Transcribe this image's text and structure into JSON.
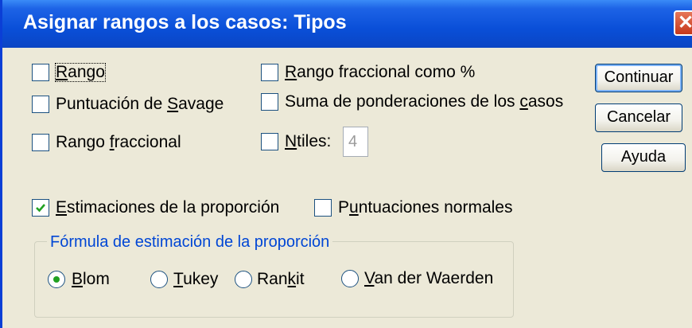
{
  "window": {
    "title": "Asignar rangos a los casos: Tipos",
    "close_icon": "close-icon"
  },
  "checkboxes": [
    {
      "key": "rango",
      "pre": "",
      "acc": "R",
      "post": "ango",
      "checked": false
    },
    {
      "key": "savage",
      "pre": "Puntuación de ",
      "acc": "S",
      "post": "avage",
      "checked": false
    },
    {
      "key": "rango_fraccional",
      "pre": "Rango ",
      "acc": "f",
      "post": "raccional",
      "checked": false
    },
    {
      "key": "rango_pct",
      "pre": "",
      "acc": "R",
      "post": "ango fraccional como %",
      "checked": false
    },
    {
      "key": "suma_pond",
      "pre": "Suma de ponderaciones de los ",
      "acc": "c",
      "post": "asos",
      "checked": false
    },
    {
      "key": "ntiles",
      "pre": "",
      "acc": "N",
      "post": "tiles:",
      "checked": false
    },
    {
      "key": "estimaciones",
      "pre": "",
      "acc": "E",
      "post": "stimaciones de la proporción",
      "checked": true
    },
    {
      "key": "normales",
      "pre": "P",
      "acc": "u",
      "post": "ntuaciones normales",
      "checked": false
    }
  ],
  "ntiles_value": "4",
  "buttons": {
    "continuar": "Continuar",
    "cancelar": "Cancelar",
    "ayuda": "Ayuda"
  },
  "group": {
    "legend": "Fórmula de estimación de la proporción",
    "radios": [
      {
        "key": "blom",
        "pre": "",
        "acc": "B",
        "post": "lom",
        "selected": true
      },
      {
        "key": "tukey",
        "pre": "",
        "acc": "T",
        "post": "ukey",
        "selected": false
      },
      {
        "key": "rankit",
        "pre": "Ran",
        "acc": "k",
        "post": "it",
        "selected": false
      },
      {
        "key": "vdw",
        "pre": "",
        "acc": "V",
        "post": "an der Waerden",
        "selected": false
      }
    ]
  }
}
